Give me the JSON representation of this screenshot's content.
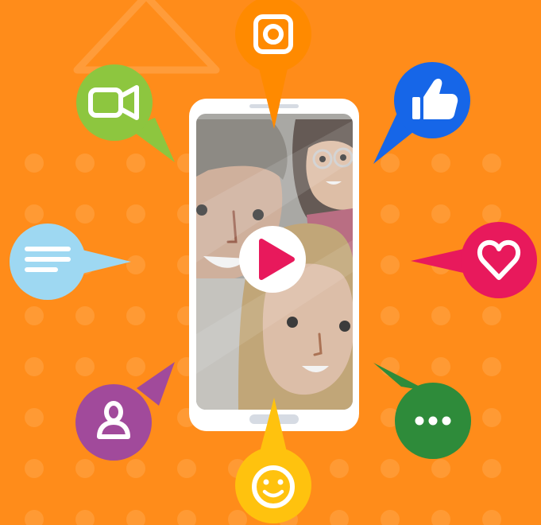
{
  "colors": {
    "background": "#FF8C1A",
    "dots": "#FFA54A",
    "triangle": "#FFAA55",
    "phone_frame": "#FFFFFF",
    "screen": "#9E9C98",
    "play_button": "#FFFFFF",
    "play_icon": "#E8195C"
  },
  "bubbles": [
    {
      "name": "video-call-bubble",
      "icon": "video-camera-icon",
      "color": "#8DC63F"
    },
    {
      "name": "instagram-bubble",
      "icon": "instagram-icon",
      "color": "#FF8A00"
    },
    {
      "name": "like-bubble",
      "icon": "thumbs-up-icon",
      "color": "#1666E8"
    },
    {
      "name": "message-bubble",
      "icon": "text-lines-icon",
      "color": "#9ED8F2"
    },
    {
      "name": "heart-bubble",
      "icon": "heart-icon",
      "color": "#E8195C"
    },
    {
      "name": "profile-bubble",
      "icon": "user-icon",
      "color": "#A14A9B"
    },
    {
      "name": "more-bubble",
      "icon": "ellipsis-icon",
      "color": "#2E8B3A"
    },
    {
      "name": "emoji-bubble",
      "icon": "smiley-icon",
      "color": "#FFC20E"
    }
  ],
  "phone": {
    "screen_content": "group-selfie-illustration",
    "overlay_icon": "play-icon"
  }
}
